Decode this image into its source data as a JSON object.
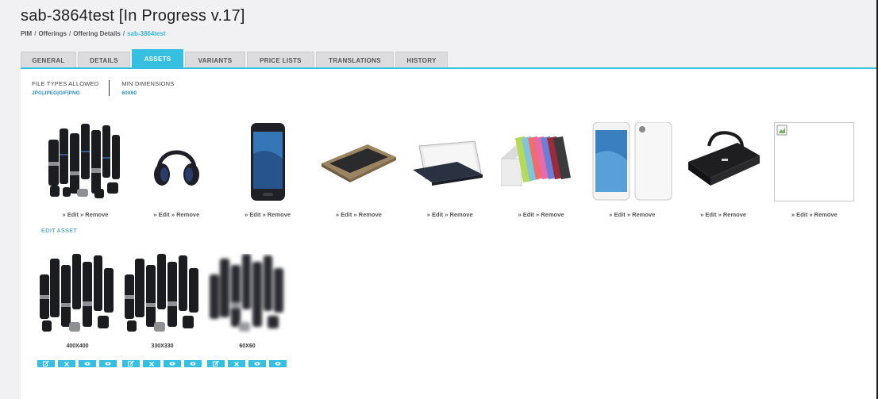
{
  "page": {
    "title": "sab-3864test [In Progress v.17]",
    "breadcrumb": [
      "PIM",
      "Offerings",
      "Offering Details",
      "sab-3864test"
    ]
  },
  "tabs": [
    "GENERAL",
    "DETAILS",
    "ASSETS",
    "VARIANTS",
    "PRICE LISTS",
    "TRANSLATIONS",
    "HISTORY"
  ],
  "active_tab": "ASSETS",
  "file_meta": {
    "types_label": "FILE TYPES ALLOWED",
    "types_value": "JPG|JPEG|GIF|PNG",
    "dims_label": "MIN DIMENSIONS",
    "dims_value": "60X60"
  },
  "assets": [
    {
      "kind": "lenses-thumbnail",
      "edit": "» Edit",
      "remove": "» Remove"
    },
    {
      "kind": "headphones-thumbnail",
      "edit": "» Edit",
      "remove": "» Remove"
    },
    {
      "kind": "smartphone-thumbnail",
      "edit": "» Edit",
      "remove": "» Remove"
    },
    {
      "kind": "keyboard-thumbnail",
      "edit": "» Edit",
      "remove": "» Remove"
    },
    {
      "kind": "tablet-case-thumbnail",
      "edit": "» Edit",
      "remove": "» Remove"
    },
    {
      "kind": "colored-covers-thumbnail",
      "edit": "» Edit",
      "remove": "» Remove"
    },
    {
      "kind": "white-phone-thumbnail",
      "edit": "» Edit",
      "remove": "» Remove"
    },
    {
      "kind": "laptop-bag-thumbnail",
      "edit": "» Edit",
      "remove": "» Remove"
    },
    {
      "kind": "broken-image-thumbnail",
      "edit": "» Edit",
      "remove": "» Remove"
    }
  ],
  "edit_asset_label": "EDIT ASSET",
  "sizes": [
    {
      "label": "400X400"
    },
    {
      "label": "330X330"
    },
    {
      "label": "60X60"
    }
  ],
  "size_buttons": [
    "edit-icon",
    "close-icon",
    "eye-icon",
    "eye-icon"
  ],
  "colors": {
    "accent": "#35bfe0",
    "link": "#2b8fbf",
    "background": "#f1f1f3"
  }
}
